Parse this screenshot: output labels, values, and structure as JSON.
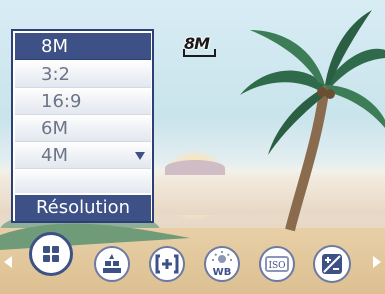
{
  "menu": {
    "title": "Résolution",
    "items": [
      {
        "label": "8M",
        "selected": true
      },
      {
        "label": "3:2",
        "selected": false
      },
      {
        "label": "16:9",
        "selected": false
      },
      {
        "label": "6M",
        "selected": false
      },
      {
        "label": "4M",
        "selected": false
      }
    ],
    "more_indicator": "scroll-down-arrow-icon"
  },
  "status": {
    "resolution_badge": "8M"
  },
  "iconbar": {
    "icons": [
      "resolution-icon",
      "quality-icon",
      "macro-focus-icon",
      "white-balance-icon",
      "iso-icon",
      "exposure-compensation-icon"
    ],
    "iso_text": "ISO",
    "wb_text": "WB"
  },
  "colors": {
    "accent": "#3e5187",
    "menu_text": "#6d7588"
  }
}
